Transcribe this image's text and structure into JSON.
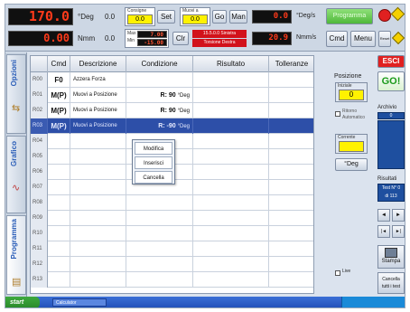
{
  "top": {
    "pos1_value": "170.0",
    "pos1_unit": "°Deg",
    "offset1": "0.0",
    "setpoint_label": "Consigne",
    "setpoint_value": "0.0",
    "set_button": "Set",
    "move_label": "Muovi a",
    "move_value": "0.0",
    "go_button": "Go",
    "man_button": "Man",
    "speed_value": "0.0",
    "speed_unit": "°Deg/s",
    "programma_button": "Programma",
    "torque_value": "0.00",
    "torque_unit": "Nmm",
    "offset2": "0.0",
    "max_label": "Max",
    "max_value": "7.00",
    "min_label": "Min",
    "min_value": "-15.00",
    "clr_button": "Clr",
    "red_line1": "15.5.0.0 Sinistra",
    "red_line2": "Torsione Destra",
    "force_value": "20.9",
    "force_unit": "Nmm/s",
    "cmd_button": "Cmd",
    "menu_button": "Menu",
    "reset_button": "Reset"
  },
  "tabs": {
    "opzioni": "Opzioni",
    "grafico": "Grafico",
    "programma": "Programma"
  },
  "table": {
    "headers": {
      "cmd": "Cmd",
      "desc": "Descrizione",
      "cond": "Condizione",
      "res": "Risultato",
      "tol": "Tolleranze"
    },
    "rows": [
      {
        "id": "R00",
        "cmd": "F0",
        "desc": "Azzera Forza",
        "cond": "",
        "unit": ""
      },
      {
        "id": "R01",
        "cmd": "M(P)",
        "desc": "Muovi a Posizione",
        "cond": "R: 90",
        "unit": "°Deg"
      },
      {
        "id": "R02",
        "cmd": "M(P)",
        "desc": "Muovi a Posizione",
        "cond": "R: 90",
        "unit": "°Deg"
      },
      {
        "id": "R03",
        "cmd": "M(P)",
        "desc": "Muovi a Posizione",
        "cond": "R: -90",
        "unit": "°Deg"
      },
      {
        "id": "R04",
        "cmd": "",
        "desc": "",
        "cond": "",
        "unit": ""
      },
      {
        "id": "R05",
        "cmd": "",
        "desc": "",
        "cond": "",
        "unit": ""
      },
      {
        "id": "R06",
        "cmd": "",
        "desc": "",
        "cond": "",
        "unit": ""
      },
      {
        "id": "R07",
        "cmd": "",
        "desc": "",
        "cond": "",
        "unit": ""
      },
      {
        "id": "R08",
        "cmd": "",
        "desc": "",
        "cond": "",
        "unit": ""
      },
      {
        "id": "R09",
        "cmd": "",
        "desc": "",
        "cond": "",
        "unit": ""
      },
      {
        "id": "R10",
        "cmd": "",
        "desc": "",
        "cond": "",
        "unit": ""
      },
      {
        "id": "R11",
        "cmd": "",
        "desc": "",
        "cond": "",
        "unit": ""
      },
      {
        "id": "R12",
        "cmd": "",
        "desc": "",
        "cond": "",
        "unit": ""
      },
      {
        "id": "R13",
        "cmd": "",
        "desc": "",
        "cond": "",
        "unit": ""
      }
    ]
  },
  "context_menu": {
    "modifica": "Modifica",
    "inserisci": "Inserisci",
    "cancella": "Cancella"
  },
  "right": {
    "esci": "ESCI",
    "go": "GO!",
    "posizione_label": "Posizione",
    "iniziale_label": "Iniziale",
    "iniziale_value": "0",
    "ritorno_label": "Ritorno",
    "automatico_label": "Automatico",
    "corrente_label": "Corrente",
    "unit_button": "°Deg",
    "archivio_label": "Archivio",
    "archivio_value": "0",
    "risultati_label": "Risultati",
    "test_line1": "Test N° 0",
    "test_line2": "di 113",
    "nav_prev": "◄",
    "nav_next": "►",
    "nav_first": "|◄",
    "nav_last": "►|",
    "stampa": "Stampa",
    "cancella_tutti": "Cancella tutti i test",
    "live_label": "Live"
  },
  "taskbar": {
    "start": "start",
    "app": "Calculator"
  }
}
